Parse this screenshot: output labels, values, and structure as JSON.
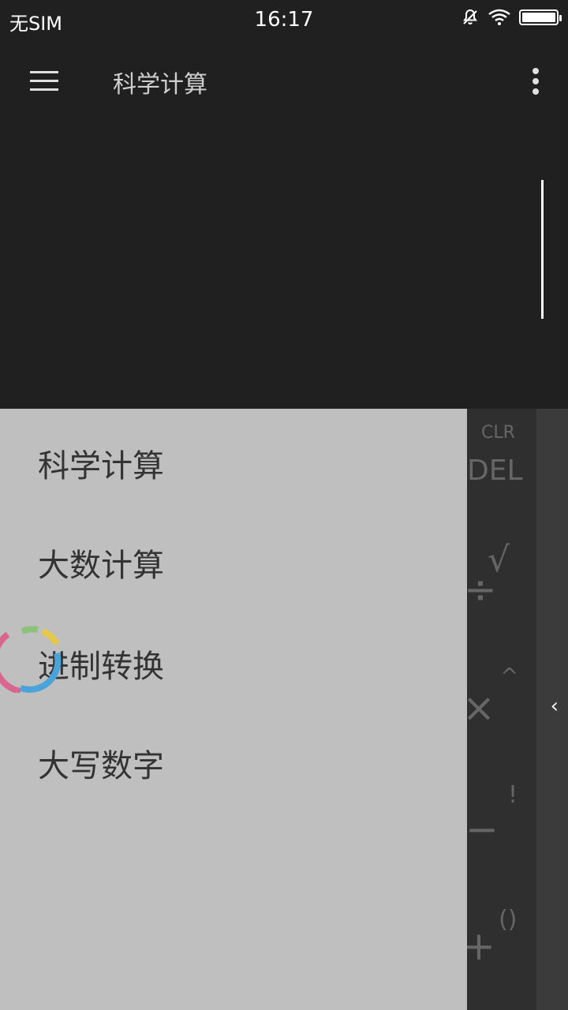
{
  "status_bar": {
    "carrier": "无SIM",
    "time": "16:17",
    "icons": [
      "bell-off-icon",
      "wifi-icon",
      "battery-icon"
    ]
  },
  "app_bar": {
    "title": "科学计算",
    "menu_icon": "hamburger-icon",
    "overflow_icon": "more-vertical-icon"
  },
  "keypad": {
    "keys": [
      "CLR",
      "DEL",
      "√",
      "÷",
      "^",
      "×",
      "!",
      "−",
      "()",
      "+"
    ],
    "side_arrow": "‹"
  },
  "drawer": {
    "items": [
      {
        "label": "科学计算"
      },
      {
        "label": "大数计算"
      },
      {
        "label": "进制转换"
      },
      {
        "label": "大写数字"
      }
    ]
  },
  "colors": {
    "background": "#202020",
    "drawer": "#bfbfbf",
    "keypad": "#2f2f2f",
    "side_panel": "#3b3b3b",
    "spinner_pink": "#d9668f",
    "spinner_green": "#8dc07a",
    "spinner_yellow": "#e6c84a",
    "spinner_blue": "#4aa3d9"
  }
}
